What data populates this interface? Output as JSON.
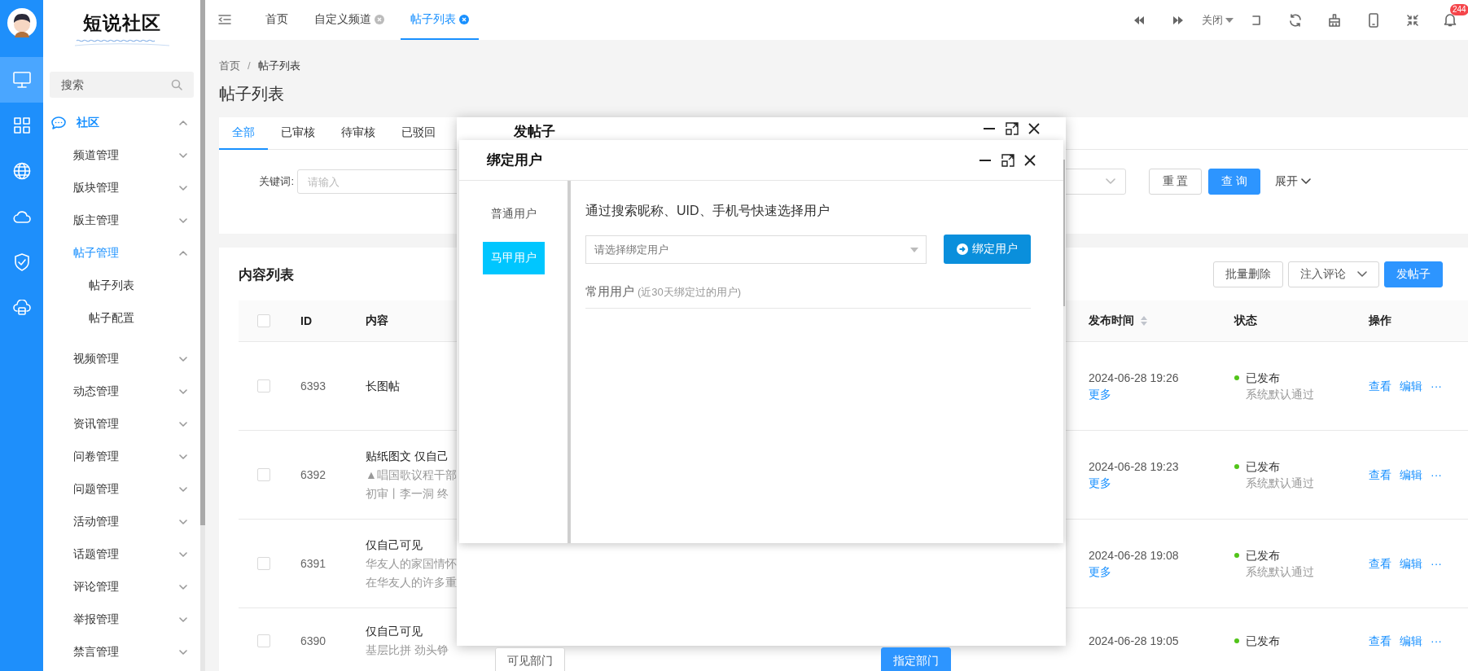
{
  "rail": {
    "items": [
      {
        "selected": true
      },
      {
        "selected": false
      },
      {
        "selected": false
      },
      {
        "selected": false
      },
      {
        "selected": false
      },
      {
        "selected": false
      }
    ]
  },
  "sidebar": {
    "logo": "短说社区",
    "search": {
      "placeholder": "搜索"
    },
    "menu": [
      {
        "label": "社区",
        "active": true,
        "expanded": true,
        "children": [
          {
            "label": "频道管理",
            "active": false,
            "expanded": false
          },
          {
            "label": "版块管理",
            "active": false,
            "expanded": false
          },
          {
            "label": "版主管理",
            "active": false,
            "expanded": false
          },
          {
            "label": "帖子管理",
            "active": true,
            "expanded": true,
            "children": [
              {
                "label": "帖子列表"
              },
              {
                "label": "帖子配置"
              }
            ]
          },
          {
            "label": "视频管理",
            "active": false,
            "expanded": false
          },
          {
            "label": "动态管理",
            "active": false,
            "expanded": false
          },
          {
            "label": "资讯管理",
            "active": false,
            "expanded": false
          },
          {
            "label": "问卷管理",
            "active": false,
            "expanded": false
          },
          {
            "label": "问题管理",
            "active": false,
            "expanded": false
          },
          {
            "label": "活动管理",
            "active": false,
            "expanded": false
          },
          {
            "label": "话题管理",
            "active": false,
            "expanded": false
          },
          {
            "label": "评论管理",
            "active": false,
            "expanded": false
          },
          {
            "label": "举报管理",
            "active": false,
            "expanded": false
          },
          {
            "label": "禁言管理",
            "active": false,
            "expanded": false
          }
        ]
      }
    ]
  },
  "topbar": {
    "tabs": [
      {
        "label": "首页",
        "closable": false,
        "selected": false
      },
      {
        "label": "自定义频道",
        "closable": true,
        "selected": false
      },
      {
        "label": "帖子列表",
        "closable": true,
        "selected": true
      }
    ],
    "close_menu": "关闭",
    "notification_badge": "244"
  },
  "breadcrumb": {
    "items": [
      "首页",
      "帖子列表"
    ],
    "separator": "/"
  },
  "page_title": "帖子列表",
  "status_tabs": [
    {
      "label": "全部",
      "selected": true
    },
    {
      "label": "已审核",
      "selected": false
    },
    {
      "label": "待审核",
      "selected": false
    },
    {
      "label": "已驳回",
      "selected": false
    }
  ],
  "filter": {
    "label": "关键词:",
    "placeholder": "请输入",
    "reset": "重 置",
    "query": "查 询",
    "expand": "展开"
  },
  "list": {
    "title": "内容列表",
    "actions": [
      {
        "label": "批量删除",
        "kind": "default"
      },
      {
        "label": "注入评论",
        "kind": "dropdown"
      },
      {
        "label": "发帖子",
        "kind": "primary"
      }
    ],
    "table": {
      "header_checked": false,
      "columns": [
        {
          "label": "ID",
          "sortable": false
        },
        {
          "label": "内容",
          "sortable": false
        },
        {
          "label": "发布时间",
          "sortable": true
        },
        {
          "label": "状态",
          "sortable": false
        },
        {
          "label": "操作",
          "sortable": false
        }
      ],
      "rows": [
        {
          "checked": false,
          "id": "6393",
          "title": "长图帖",
          "lines": [],
          "time": "2024-06-28 19:26",
          "more": "更多",
          "status": "已发布",
          "color": "#52c41a",
          "note": "系统默认通过",
          "actions": [
            "查看",
            "编辑",
            "···"
          ]
        },
        {
          "checked": false,
          "id": "6392",
          "title": "贴纸图文 仅自己",
          "lines": [
            "▲唱国歌议程干部",
            "初审丨李一洞 终"
          ],
          "time": "2024-06-28 19:23",
          "more": "更多",
          "status": "已发布",
          "color": "#52c41a",
          "note": "系统默认通过",
          "actions": [
            "查看",
            "编辑",
            "···"
          ]
        },
        {
          "checked": false,
          "id": "6391",
          "title": "仅自己可见",
          "lines": [
            "华友人的家国情怀",
            "在华友人的许多重"
          ],
          "time": "2024-06-28 19:08",
          "more": "更多",
          "status": "已发布",
          "color": "#52c41a",
          "note": "系统默认通过",
          "actions": [
            "查看",
            "编辑",
            "···"
          ]
        },
        {
          "checked": false,
          "id": "6390",
          "title": "仅自己可见",
          "lines": [
            "基层比拼 劲头铮"
          ],
          "time": "2024-06-28 19:05",
          "status": "已发布",
          "color": "#52c41a",
          "actions": [
            "查看",
            "编辑",
            "···"
          ]
        }
      ]
    }
  },
  "back_dialog": {
    "title": "发帖子",
    "buttons": [
      {
        "label": "可见部门",
        "kind": "default"
      },
      {
        "label": "指定部门",
        "kind": "primary"
      }
    ]
  },
  "bind_dialog": {
    "title": "绑定用户",
    "side_tabs": [
      {
        "label": "普通用户",
        "selected": false
      },
      {
        "label": "马甲用户",
        "selected": true
      }
    ],
    "hint": "通过搜索昵称、UID、手机号快速选择用户",
    "user_select": {
      "placeholder": "请选择绑定用户"
    },
    "bind_button": "绑定用户",
    "frequent": {
      "title": "常用用户",
      "note": "(近30天绑定过的用户)"
    }
  }
}
